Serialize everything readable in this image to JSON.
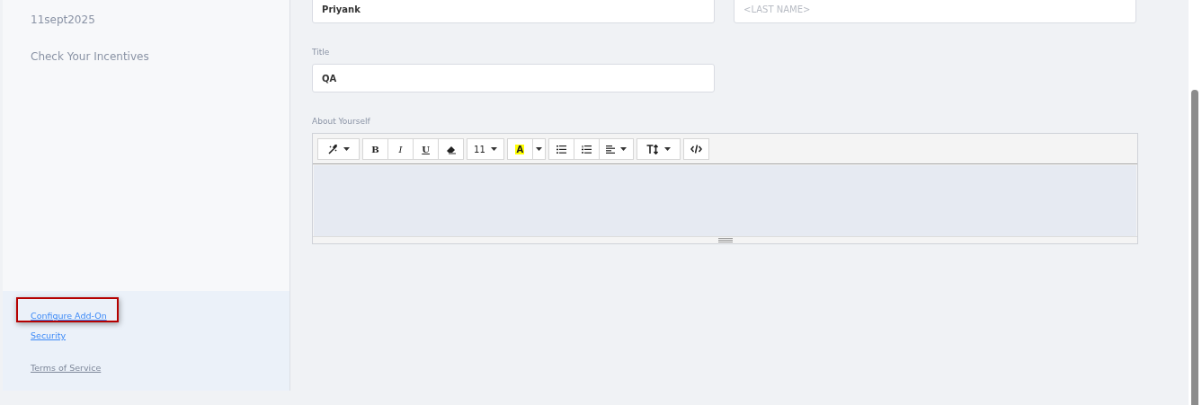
{
  "sidebar": {
    "items": [
      "11sept2025",
      "Check Your Incentives"
    ],
    "links": [
      {
        "label": "Configure Add-On",
        "visited": false,
        "highlighted": true
      },
      {
        "label": "Security",
        "visited": false,
        "highlighted": false
      },
      {
        "label": "Terms of Service",
        "visited": true,
        "highlighted": false
      }
    ]
  },
  "form": {
    "first_name": {
      "value": "Priyank"
    },
    "last_name": {
      "placeholder": "<LAST NAME>"
    },
    "title": {
      "label": "Title",
      "value": "QA"
    },
    "about": {
      "label": "About Yourself",
      "toolbar": [
        [
          {
            "kind": "magic",
            "caret": true
          }
        ],
        [
          {
            "kind": "bold",
            "text": "B"
          },
          {
            "kind": "italic",
            "text": "I"
          },
          {
            "kind": "underline",
            "text": "U"
          },
          {
            "kind": "eraser"
          }
        ],
        [
          {
            "kind": "fontsize",
            "text": "11",
            "caret": true
          }
        ],
        [
          {
            "kind": "highlight",
            "text": "A"
          },
          {
            "kind": "caret"
          }
        ],
        [
          {
            "kind": "ul"
          },
          {
            "kind": "ol"
          },
          {
            "kind": "align",
            "caret": true
          }
        ],
        [
          {
            "kind": "textheight",
            "caret": true
          }
        ],
        [
          {
            "kind": "code"
          }
        ]
      ]
    }
  }
}
